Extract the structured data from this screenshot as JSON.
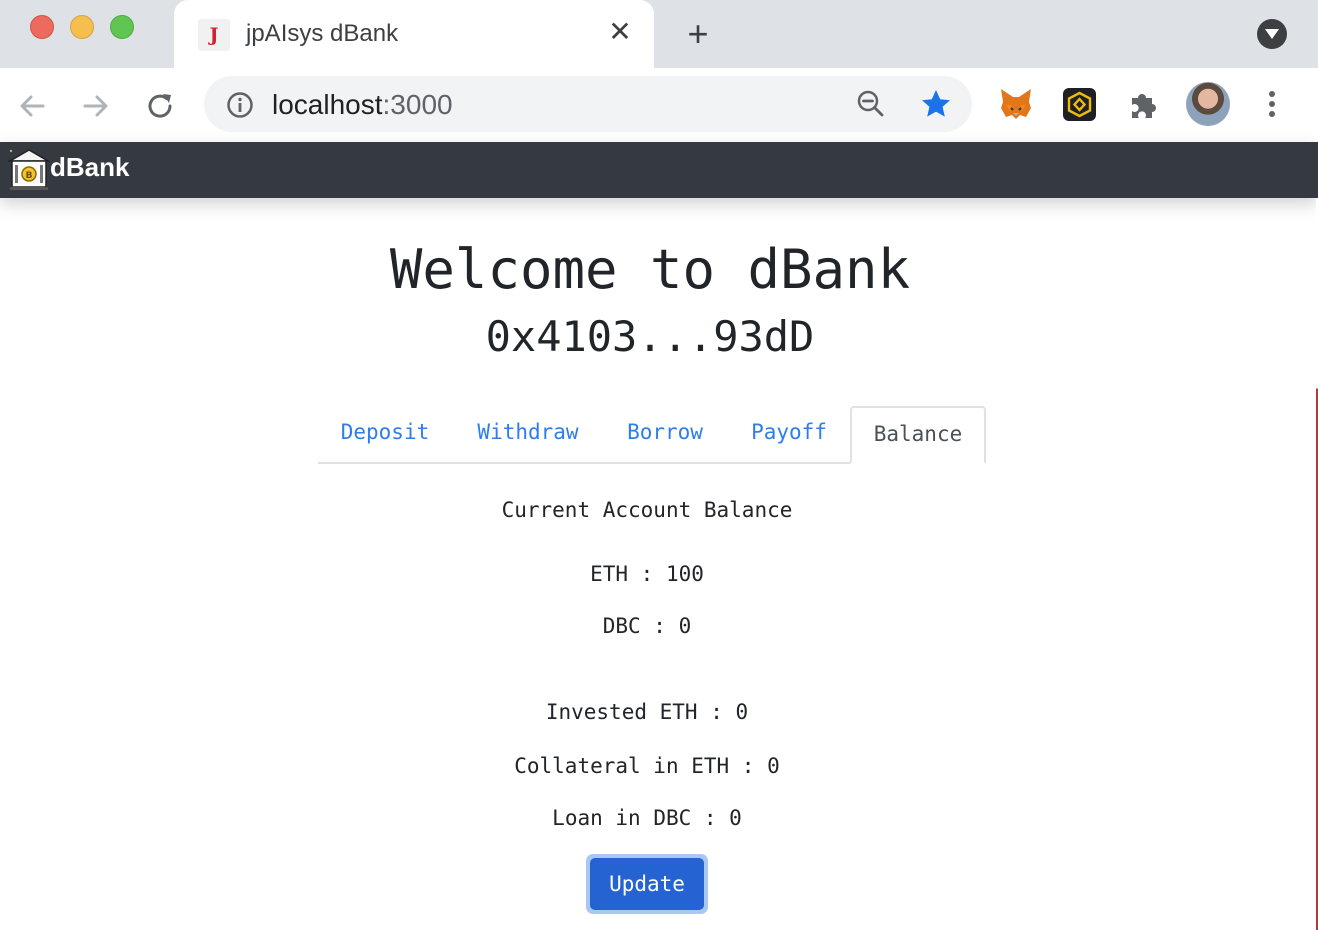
{
  "browser": {
    "tab": {
      "title": "jpAIsys dBank",
      "favicon_letter": "J",
      "close_glyph": "✕"
    },
    "new_tab_glyph": "+",
    "omnibox": {
      "host": "localhost",
      "port": ":3000"
    },
    "icons": [
      "back-icon",
      "forward-icon",
      "reload-icon",
      "info-icon",
      "zoom-out-icon",
      "bookmark-star-icon",
      "metamask-fox-icon",
      "binance-icon",
      "extensions-puzzle-icon",
      "profile-avatar",
      "more-menu-icon",
      "tab-search-icon"
    ],
    "colors": {
      "star": "#1a73e8",
      "tabstrip": "#dee1e6"
    }
  },
  "navbar": {
    "brand": "dBank",
    "color": "#343a40"
  },
  "main": {
    "welcome": "Welcome to dBank",
    "account": "0x4103...93dD",
    "tabs": [
      {
        "label": "Deposit",
        "active": false
      },
      {
        "label": "Withdraw",
        "active": false
      },
      {
        "label": "Borrow",
        "active": false
      },
      {
        "label": "Payoff",
        "active": false
      },
      {
        "label": "Balance",
        "active": true
      }
    ],
    "balance": {
      "heading": "Current Account Balance",
      "eth": "ETH : 100",
      "dbc": "DBC : 0",
      "invested_eth": "Invested ETH : 0",
      "collateral_eth": "Collateral in ETH : 0",
      "loan_dbc": "Loan in DBC : 0",
      "update_label": "Update"
    },
    "colors": {
      "link": "#2f7ded",
      "button": "#2563d3"
    }
  }
}
